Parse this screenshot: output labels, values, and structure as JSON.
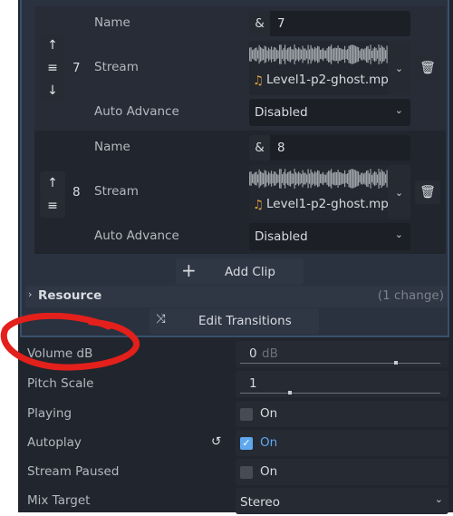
{
  "clips": [
    {
      "index": "7",
      "name_label": "Name",
      "name_prefix": "&",
      "name_value": "7",
      "stream_label": "Stream",
      "stream_file": "Level1-p2-ghost.mp",
      "auto_advance_label": "Auto Advance",
      "auto_advance_value": "Disabled"
    },
    {
      "index": "8",
      "name_label": "Name",
      "name_prefix": "&",
      "name_value": "8",
      "stream_label": "Stream",
      "stream_file": "Level1-p2-ghost.mp",
      "auto_advance_label": "Auto Advance",
      "auto_advance_value": "Disabled"
    }
  ],
  "add_clip_label": "Add Clip",
  "resource": {
    "label": "Resource",
    "changes": "(1 change)"
  },
  "edit_transitions_label": "Edit Transitions",
  "properties": {
    "volume": {
      "label": "Volume dB",
      "value": "0",
      "unit": "dB",
      "slider_fraction": 0.78
    },
    "pitch": {
      "label": "Pitch Scale",
      "value": "1",
      "slider_fraction": 0.25
    },
    "playing": {
      "label": "Playing",
      "checked": false,
      "text": "On"
    },
    "autoplay": {
      "label": "Autoplay",
      "checked": true,
      "text": "On"
    },
    "stream_paused": {
      "label": "Stream Paused",
      "checked": false,
      "text": "On"
    },
    "mix_target": {
      "label": "Mix Target",
      "value": "Stereo"
    }
  },
  "colors": {
    "accent": "#5fa8f0",
    "annotation": "#e3201b"
  }
}
